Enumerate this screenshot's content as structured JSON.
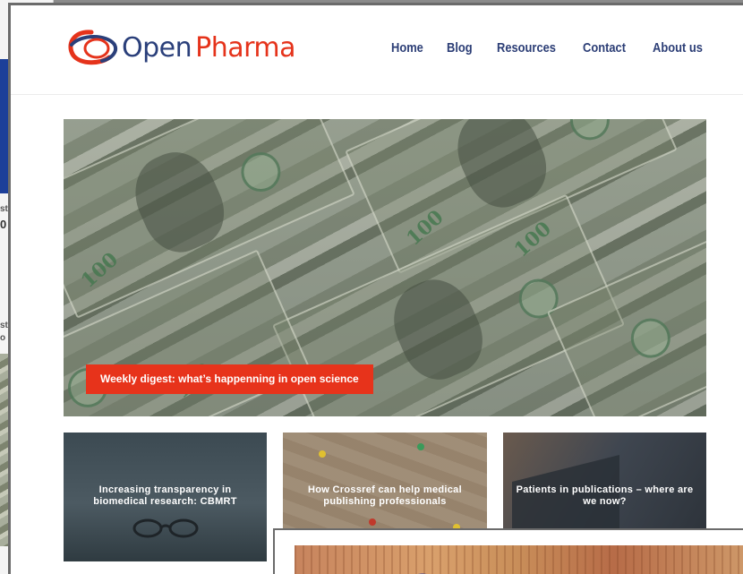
{
  "brand": {
    "logo_part1": "Open",
    "logo_part2": "Pharma",
    "logo_red": "#e5331b",
    "logo_navy": "#2a3f7a"
  },
  "nav": {
    "items": [
      "Home",
      "Blog",
      "Resources",
      "Contact",
      "About us"
    ],
    "color": "#2c3e76"
  },
  "hero": {
    "caption": "Weekly digest: what’s happenning in open science",
    "caption_bg": "#e7331b"
  },
  "cards": [
    {
      "title": "Increasing transparency in biomedical research: CBMRT",
      "image": "glasses-icon"
    },
    {
      "title": "How Crossref can help medical publishing professionals",
      "image": "pushpins-map-icon"
    },
    {
      "title": "Patients in publications – where are we now?",
      "image": "laptop-icon"
    }
  ],
  "background_window": {
    "fragments": [
      "st",
      "0",
      "st",
      "o"
    ]
  }
}
